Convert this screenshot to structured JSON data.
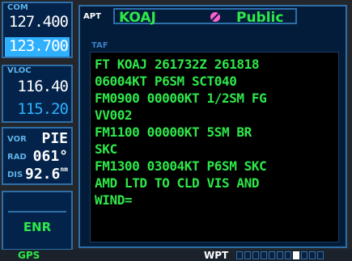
{
  "com": {
    "label": "COM",
    "active": "127.400",
    "standby": "123.700"
  },
  "vloc": {
    "label": "VLOC",
    "active": "116.40",
    "standby": "115.20"
  },
  "vor": {
    "label": "VOR",
    "ident": "PIE",
    "rad_label": "RAD",
    "radial": "061°",
    "dis_label": "DIS",
    "distance": "92.6",
    "dist_unit": "nm"
  },
  "mode": {
    "label": "ENR"
  },
  "header": {
    "prefix": "APT",
    "identifier": "KOAJ",
    "type": "Public",
    "icon": "military-airport-icon"
  },
  "taf": {
    "title": "TAF",
    "lines": [
      "FT KOAJ 261732Z 261818",
      "06004KT P6SM SCT040",
      "FM0900 00000KT 1/2SM FG",
      "VV002",
      "FM1100 00000KT 5SM BR",
      "SKC",
      "FM1300 03004KT P6SM SKC",
      "AMD LTD TO CLD VIS AND",
      "WIND="
    ]
  },
  "status": {
    "mode": "GPS",
    "page_group": "WPT",
    "page_count": 11,
    "active_page": 7
  },
  "colors": {
    "green": "#2ee84a",
    "cyan": "#2fb0ff",
    "panel": "#03234a",
    "border": "#2f6fa8"
  }
}
